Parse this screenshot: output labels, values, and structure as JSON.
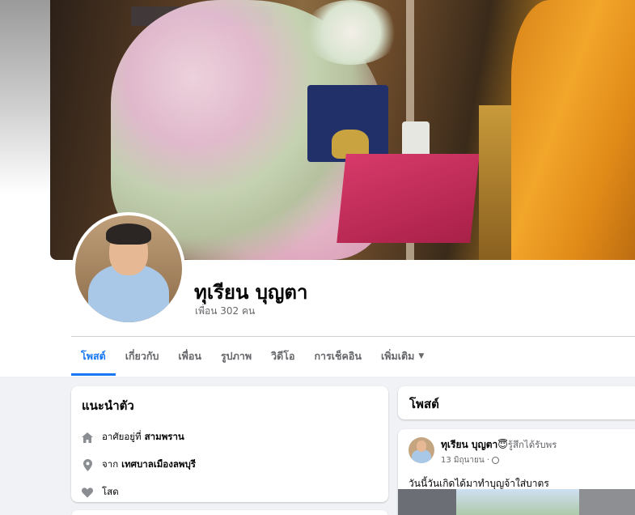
{
  "profile": {
    "name": "ทุเรียน บุญตา",
    "friends": "เพื่อน 302 คน"
  },
  "tabs": [
    {
      "label": "โพสต์",
      "active": true
    },
    {
      "label": "เกี่ยวกับ",
      "active": false
    },
    {
      "label": "เพื่อน",
      "active": false
    },
    {
      "label": "รูปภาพ",
      "active": false
    },
    {
      "label": "วิดีโอ",
      "active": false
    },
    {
      "label": "การเช็คอิน",
      "active": false
    },
    {
      "label": "เพิ่มเติม",
      "active": false
    }
  ],
  "intro": {
    "title": "แนะนำตัว",
    "lives_prefix": "อาศัยอยู่ที่",
    "lives_value": "สามพราน",
    "from_prefix": "จาก",
    "from_value": "เทศบาลเมืองลพบุรี",
    "relationship": "โสด"
  },
  "posts": {
    "title": "โพสต์",
    "first": {
      "author": "ทุเรียน บุญตา",
      "emoji": "😇",
      "feeling": "รู้สึกได้รับพร",
      "date": "13 มิถุนายน ·",
      "text": "วันนี้วันเกิดได้มาทำบุญจ้าใส่บาตร"
    }
  },
  "colors": {
    "accent": "#1877f2",
    "background": "#f0f2f5",
    "secondary_text": "#65676b"
  }
}
